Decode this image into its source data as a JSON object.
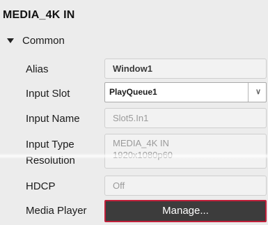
{
  "panel": {
    "title": "MEDIA_4K IN"
  },
  "section": {
    "label": "Common"
  },
  "props": {
    "alias": {
      "label": "Alias",
      "value": "Window1"
    },
    "input_slot": {
      "label": "Input Slot",
      "value": "PlayQueue1"
    },
    "input_name": {
      "label": "Input Name",
      "value": "Slot5.In1"
    },
    "input_type": {
      "label": "Input Type",
      "value": "MEDIA_4K IN"
    },
    "resolution": {
      "label": "Resolution",
      "value": "1920x1080p60"
    },
    "hdcp": {
      "label": "HDCP",
      "value": "Off"
    },
    "media_player": {
      "label": "Media Player",
      "button": "Manage..."
    }
  },
  "icons": {
    "section_toggle": "triangle-down-icon",
    "select_chevron": "chevron-down-icon"
  },
  "colors": {
    "accent_border": "#c0203a",
    "button_bg": "#3c3c3c"
  }
}
